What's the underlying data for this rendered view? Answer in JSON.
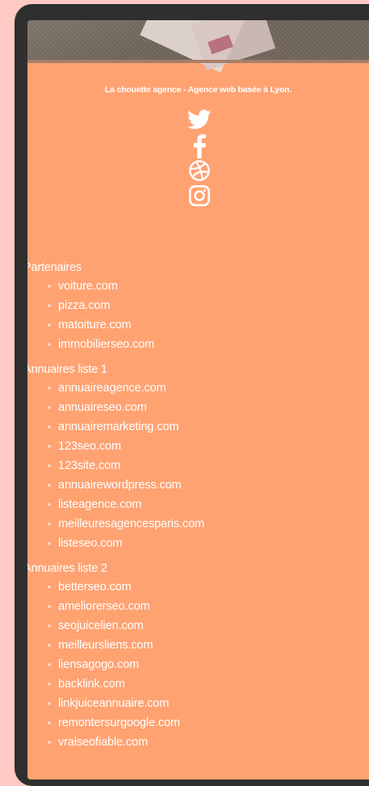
{
  "footer": {
    "tagline": "La chouette agence - Agence web basée à Lyon."
  },
  "socials": [
    {
      "name": "twitter",
      "icon": "twitter-icon"
    },
    {
      "name": "facebook",
      "icon": "facebook-icon"
    },
    {
      "name": "dribbble",
      "icon": "dribbble-icon"
    },
    {
      "name": "instagram",
      "icon": "instagram-icon"
    }
  ],
  "groups": [
    {
      "title": "Partenaires",
      "items": [
        "voiture.com",
        "pizza.com",
        "matoiture.com",
        "immobilierseo.com"
      ]
    },
    {
      "title": "Annuaires liste 1",
      "items": [
        "annuaireagence.com",
        "annuaireseo.com",
        "annuairemarketing.com",
        "123seo.com",
        "123site.com",
        "annuairewordpress.com",
        "listeagence.com",
        "meilleuresagencesparis.com",
        "listeseo.com"
      ]
    },
    {
      "title": "Annuaires liste 2",
      "items": [
        "betterseo.com",
        "ameliorerseo.com",
        "seojuicelien.com",
        "meilleursliens.com",
        "liensagogo.com",
        "backlink.com",
        "linkjuiceannuaire.com",
        "remontersurgoogle.com",
        "vraiseofiable.com"
      ]
    }
  ],
  "colors": {
    "background": "#ffc9c4",
    "device": "#2f2f2f",
    "footer": "#ffa272",
    "text": "#ffffff"
  }
}
